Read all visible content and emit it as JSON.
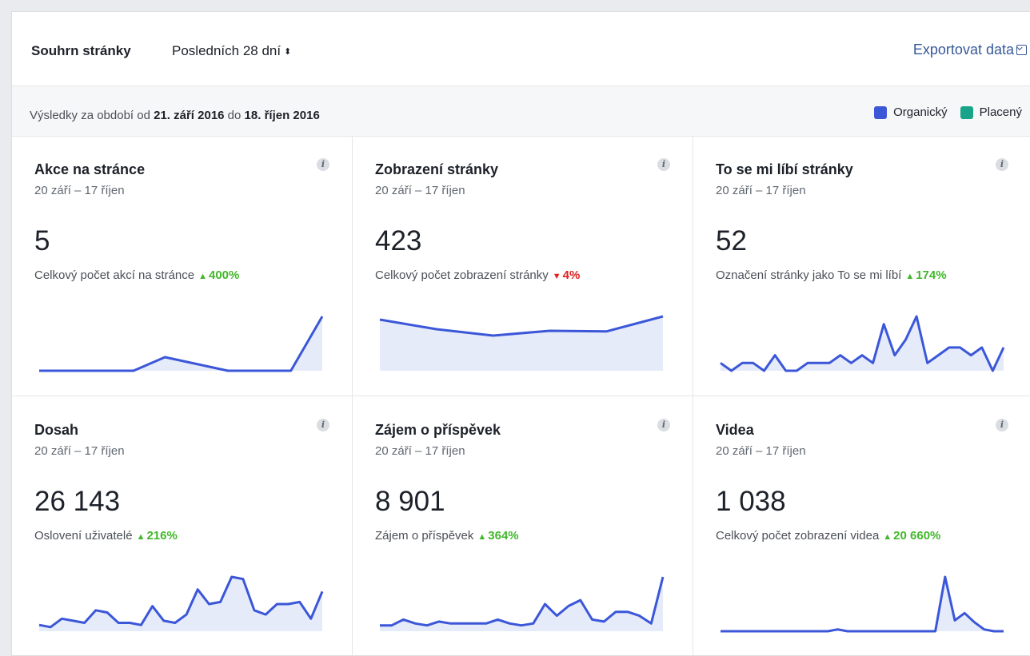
{
  "header": {
    "title": "Souhrn stránky",
    "period": "Posledních 28 dní",
    "export_label": "Exportovat data"
  },
  "subbar": {
    "range_prefix": "Výsledky za období od ",
    "range_start": "21. září 2016",
    "range_mid": " do ",
    "range_end": "18. říjen 2016"
  },
  "legend": [
    {
      "label": "Organický",
      "color": "#3b57d8"
    },
    {
      "label": "Placený",
      "color": "#17a488"
    }
  ],
  "colors": {
    "line": "#3b57d8",
    "fill": "#e6ebfa",
    "up": "#42b72a",
    "down": "#e02020"
  },
  "cards": [
    {
      "title": "Akce na stránce",
      "date": "20 září – 17 říjen",
      "value": "5",
      "desc": "Celkový počet akcí na stránce",
      "delta": "400%",
      "dir": "up",
      "series": [
        0,
        0,
        0,
        0,
        1,
        0.5,
        0,
        0,
        0,
        4
      ]
    },
    {
      "title": "Zobrazení stránky",
      "date": "20 září – 17 říjen",
      "value": "423",
      "desc": "Celkový počet zobrazení stránky",
      "delta": "4%",
      "dir": "down",
      "series": [
        16,
        13,
        11,
        12.5,
        12.3,
        17
      ]
    },
    {
      "title": "To se mi líbí stránky",
      "date": "20 září – 17 říjen",
      "value": "52",
      "desc": "Označení stránky jako To se mi líbí",
      "delta": "174%",
      "dir": "up",
      "series": [
        1,
        0,
        1,
        1,
        0,
        2,
        0,
        0,
        1,
        1,
        1,
        2,
        1,
        2,
        1,
        6,
        2,
        4,
        7,
        1,
        2,
        3,
        3,
        2,
        3,
        0,
        3
      ]
    },
    {
      "title": "Dosah",
      "date": "20 září – 17 říjen",
      "value": "26 143",
      "desc": "Oslovení uživatelé",
      "delta": "216%",
      "dir": "up",
      "series": [
        3,
        2,
        6,
        5,
        4,
        10,
        9,
        4,
        4,
        3,
        12,
        5,
        4,
        8,
        20,
        13,
        14,
        26,
        25,
        10,
        8,
        13,
        13,
        14,
        6,
        19
      ]
    },
    {
      "title": "Zájem o příspěvek",
      "date": "20 září – 17 říjen",
      "value": "8 901",
      "desc": "Zájem o příspěvek",
      "delta": "364%",
      "dir": "up",
      "series": [
        3,
        3,
        6,
        4,
        3,
        5,
        4,
        4,
        4,
        4,
        6,
        4,
        3,
        4,
        14,
        8,
        13,
        16,
        6,
        5,
        10,
        10,
        8,
        4,
        28
      ]
    },
    {
      "title": "Videa",
      "date": "20 září – 17 říjen",
      "value": "1 038",
      "desc": "Celkový počet zobrazení videa",
      "delta": "20 660%",
      "dir": "up",
      "series": [
        0,
        0,
        0,
        0,
        0,
        0,
        0,
        0,
        0,
        0,
        0,
        0,
        1,
        0,
        0,
        0,
        0,
        0,
        0,
        0,
        0,
        0,
        0,
        30,
        6,
        10,
        5,
        1,
        0,
        0
      ]
    }
  ]
}
